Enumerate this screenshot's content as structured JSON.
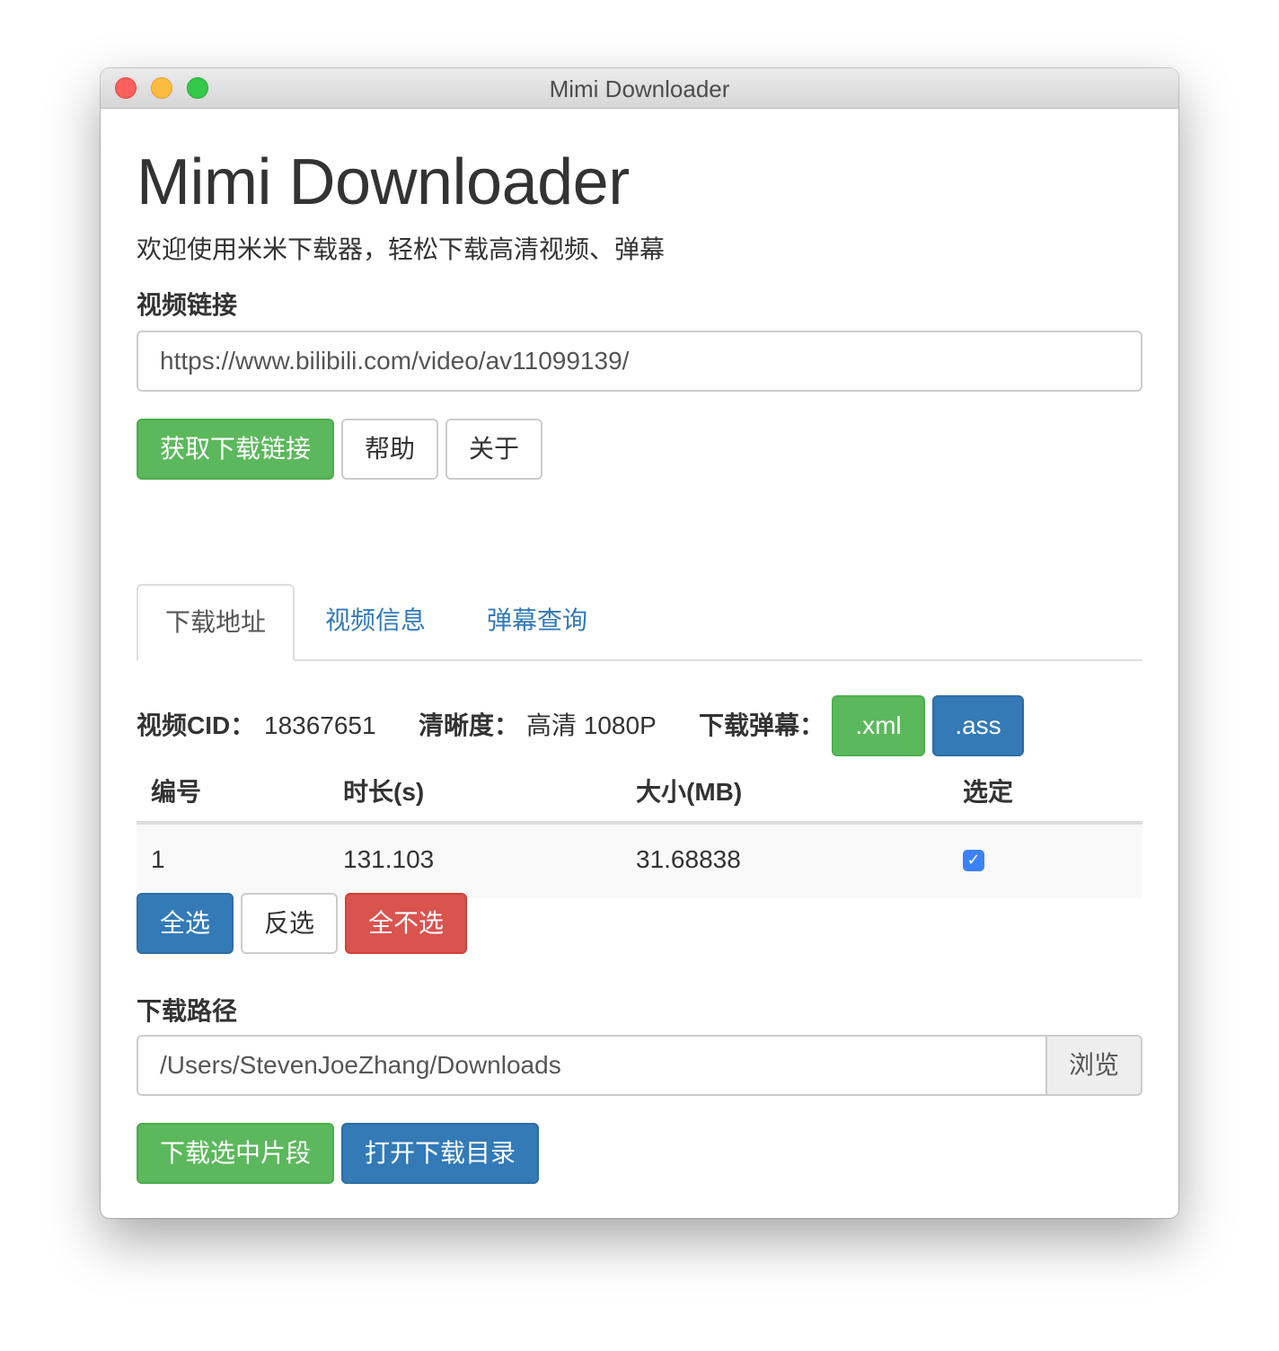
{
  "window": {
    "title": "Mimi Downloader"
  },
  "header": {
    "heading": "Mimi Downloader",
    "subtitle": "欢迎使用米米下载器，轻松下载高清视频、弹幕"
  },
  "video_link": {
    "label": "视频链接",
    "value": "https://www.bilibili.com/video/av11099139/"
  },
  "actions": {
    "get_link": "获取下载链接",
    "help": "帮助",
    "about": "关于"
  },
  "tabs": [
    {
      "label": "下载地址",
      "active": true
    },
    {
      "label": "视频信息",
      "active": false
    },
    {
      "label": "弹幕查询",
      "active": false
    }
  ],
  "info": {
    "cid_label": "视频CID：",
    "cid_value": "18367651",
    "quality_label": "清晰度：",
    "quality_value": "高清 1080P",
    "danmaku_label": "下载弹幕：",
    "xml_button": ".xml",
    "ass_button": ".ass"
  },
  "table": {
    "headers": [
      "编号",
      "时长(s)",
      "大小(MB)",
      "选定"
    ],
    "rows": [
      {
        "index": "1",
        "duration": "131.103",
        "size": "31.68838",
        "selected": true
      }
    ]
  },
  "selection": {
    "select_all": "全选",
    "invert": "反选",
    "select_none": "全不选"
  },
  "download_path": {
    "label": "下载路径",
    "value": "/Users/StevenJoeZhang/Downloads",
    "browse": "浏览"
  },
  "bottom_actions": {
    "download_selected": "下载选中片段",
    "open_folder": "打开下载目录"
  },
  "colors": {
    "success": "#5cb85c",
    "primary": "#337ab7",
    "danger": "#d9534f",
    "link": "#337ab7"
  }
}
